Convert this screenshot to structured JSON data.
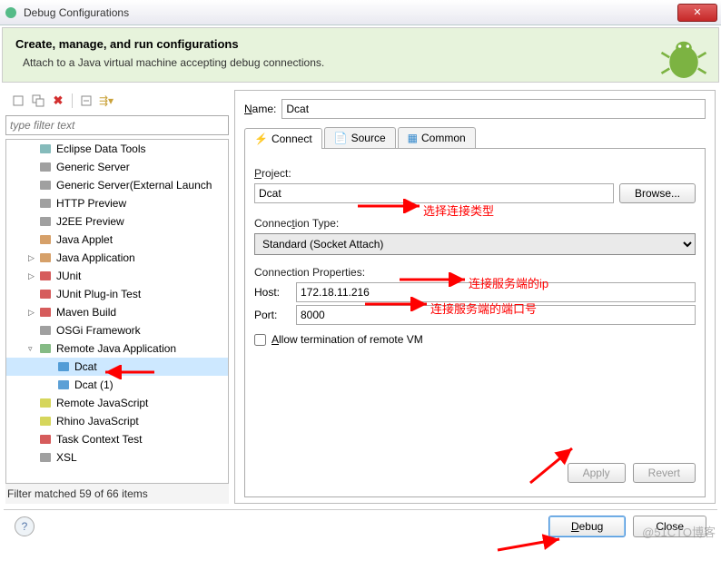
{
  "window": {
    "title": "Debug Configurations"
  },
  "header": {
    "title": "Create, manage, and run configurations",
    "subtitle": "Attach to a Java virtual machine accepting debug connections."
  },
  "left": {
    "filter_placeholder": "type filter text",
    "items": [
      {
        "label": "Eclipse Data Tools",
        "depth": 1
      },
      {
        "label": "Generic Server",
        "depth": 1
      },
      {
        "label": "Generic Server(External Launch",
        "depth": 1
      },
      {
        "label": "HTTP Preview",
        "depth": 1
      },
      {
        "label": "J2EE Preview",
        "depth": 1
      },
      {
        "label": "Java Applet",
        "depth": 1
      },
      {
        "label": "Java Application",
        "depth": 1,
        "twist": "▷"
      },
      {
        "label": "JUnit",
        "depth": 1,
        "twist": "▷"
      },
      {
        "label": "JUnit Plug-in Test",
        "depth": 1
      },
      {
        "label": "Maven Build",
        "depth": 1,
        "twist": "▷"
      },
      {
        "label": "OSGi Framework",
        "depth": 1
      },
      {
        "label": "Remote Java Application",
        "depth": 1,
        "twist": "▿"
      },
      {
        "label": "Dcat",
        "depth": 2,
        "selected": true
      },
      {
        "label": "Dcat (1)",
        "depth": 2
      },
      {
        "label": "Remote JavaScript",
        "depth": 1
      },
      {
        "label": "Rhino JavaScript",
        "depth": 1
      },
      {
        "label": "Task Context Test",
        "depth": 1
      },
      {
        "label": "XSL",
        "depth": 1
      }
    ],
    "status": "Filter matched 59 of 66 items"
  },
  "form": {
    "name_label": "Name:",
    "name_value": "Dcat",
    "tabs": {
      "connect": "Connect",
      "source": "Source",
      "common": "Common"
    },
    "project_label": "Project:",
    "project_value": "Dcat",
    "browse": "Browse...",
    "conn_type_label": "Connection Type:",
    "conn_type_value": "Standard (Socket Attach)",
    "conn_props_label": "Connection Properties:",
    "host_label": "Host:",
    "host_value": "172.18.11.216",
    "port_label": "Port:",
    "port_value": "8000",
    "allow_term": "Allow termination of remote VM",
    "apply": "Apply",
    "revert": "Revert"
  },
  "footer": {
    "debug": "Debug",
    "close": "Close"
  },
  "annotations": {
    "a1": "选择连接类型",
    "a2": "连接服务端的ip",
    "a3": "连接服务端的端口号"
  },
  "watermark": "@51CTO博客"
}
